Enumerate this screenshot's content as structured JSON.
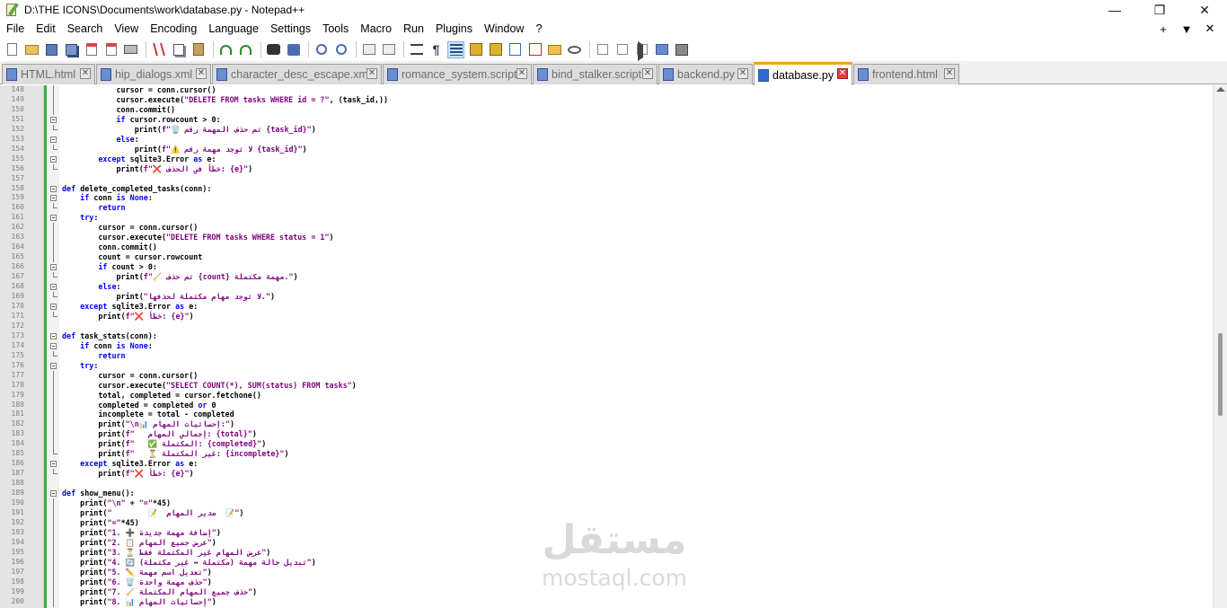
{
  "window": {
    "title": "D:\\THE ICONS\\Documents\\work\\database.py - Notepad++",
    "controls": {
      "minimize": "—",
      "maximize": "❐",
      "close": "✕"
    }
  },
  "menu": {
    "items": [
      "File",
      "Edit",
      "Search",
      "View",
      "Encoding",
      "Language",
      "Settings",
      "Tools",
      "Macro",
      "Run",
      "Plugins",
      "Window",
      "?"
    ],
    "right": [
      "+",
      "▼",
      "✕"
    ]
  },
  "toolbar": {
    "icons": [
      "new-file-icon",
      "open-file-icon",
      "save-icon",
      "save-all-icon",
      "close-file-icon",
      "close-all-icon",
      "print-icon",
      "cut-icon",
      "copy-icon",
      "paste-icon",
      "undo-icon",
      "redo-icon",
      "find-icon",
      "replace-icon",
      "zoom-in-icon",
      "zoom-out-icon",
      "sync-vertical-icon",
      "sync-horizontal-icon",
      "word-wrap-icon",
      "show-all-chars-icon",
      "indent-guide-icon",
      "user-language-icon",
      "document-map-icon",
      "document-list-icon",
      "function-list-icon",
      "folder-workspace-icon",
      "monitoring-icon",
      "record-macro-icon",
      "stop-macro-icon",
      "play-macro-icon",
      "run-macro-multiple-icon",
      "save-macro-icon"
    ],
    "active_icon": "indent-guide-icon",
    "pilcrow": "¶"
  },
  "tabs": [
    {
      "label": "HTML.html",
      "active": false
    },
    {
      "label": "hip_dialogs.xml",
      "active": false
    },
    {
      "label": "character_desc_escape.xml",
      "active": false
    },
    {
      "label": "romance_system.script",
      "active": false
    },
    {
      "label": "bind_stalker.script",
      "active": false
    },
    {
      "label": "backend.py",
      "active": false
    },
    {
      "label": "database.py",
      "active": true
    },
    {
      "label": "frontend.html",
      "active": false
    }
  ],
  "tab_close_glyph": "✕",
  "editor": {
    "lines": [
      {
        "n": "148",
        "fold": "line",
        "code": "            cursor = conn.cursor()"
      },
      {
        "n": "149",
        "fold": "line",
        "code": "            cursor.execute(\"DELETE FROM tasks WHERE id = ?\", (task_id,))"
      },
      {
        "n": "150",
        "fold": "line",
        "code": "            conn.commit()"
      },
      {
        "n": "151",
        "fold": "box",
        "code": "            if cursor.rowcount > 0:"
      },
      {
        "n": "152",
        "fold": "end",
        "code": "                print(f\"🗑️ تم حذف المهمة رقم {task_id}\")"
      },
      {
        "n": "153",
        "fold": "box",
        "code": "            else:"
      },
      {
        "n": "154",
        "fold": "end",
        "code": "                print(f\"⚠️ لا توجد مهمة رقم {task_id}\")"
      },
      {
        "n": "155",
        "fold": "box",
        "code": "        except sqlite3.Error as e:"
      },
      {
        "n": "156",
        "fold": "end",
        "code": "            print(f\"❌ خطأ في الحذف: {e}\")"
      },
      {
        "n": "157",
        "fold": "",
        "code": ""
      },
      {
        "n": "158",
        "fold": "box",
        "code": "def delete_completed_tasks(conn):"
      },
      {
        "n": "159",
        "fold": "box",
        "code": "    if conn is None:"
      },
      {
        "n": "160",
        "fold": "end",
        "code": "        return"
      },
      {
        "n": "161",
        "fold": "box",
        "code": "    try:"
      },
      {
        "n": "162",
        "fold": "line",
        "code": "        cursor = conn.cursor()"
      },
      {
        "n": "163",
        "fold": "line",
        "code": "        cursor.execute(\"DELETE FROM tasks WHERE status = 1\")"
      },
      {
        "n": "164",
        "fold": "line",
        "code": "        conn.commit()"
      },
      {
        "n": "165",
        "fold": "line",
        "code": "        count = cursor.rowcount"
      },
      {
        "n": "166",
        "fold": "box",
        "code": "        if count > 0:"
      },
      {
        "n": "167",
        "fold": "end",
        "code": "            print(f\"🧹 تم حذف {count} مهمة مكتملة.\")"
      },
      {
        "n": "168",
        "fold": "box",
        "code": "        else:"
      },
      {
        "n": "169",
        "fold": "end",
        "code": "            print(\"لا توجد مهام مكتملة لحذفها.\")"
      },
      {
        "n": "170",
        "fold": "box",
        "code": "    except sqlite3.Error as e:"
      },
      {
        "n": "171",
        "fold": "end",
        "code": "        print(f\"❌ خطأ: {e}\")"
      },
      {
        "n": "172",
        "fold": "",
        "code": ""
      },
      {
        "n": "173",
        "fold": "box",
        "code": "def task_stats(conn):"
      },
      {
        "n": "174",
        "fold": "box",
        "code": "    if conn is None:"
      },
      {
        "n": "175",
        "fold": "end",
        "code": "        return"
      },
      {
        "n": "176",
        "fold": "box",
        "code": "    try:"
      },
      {
        "n": "177",
        "fold": "line",
        "code": "        cursor = conn.cursor()"
      },
      {
        "n": "178",
        "fold": "line",
        "code": "        cursor.execute(\"SELECT COUNT(*), SUM(status) FROM tasks\")"
      },
      {
        "n": "179",
        "fold": "line",
        "code": "        total, completed = cursor.fetchone()"
      },
      {
        "n": "180",
        "fold": "line",
        "code": "        completed = completed or 0"
      },
      {
        "n": "181",
        "fold": "line",
        "code": "        incomplete = total - completed"
      },
      {
        "n": "182",
        "fold": "line",
        "code": "        print(\"\\n📊 إحصائيات المهام:\")"
      },
      {
        "n": "183",
        "fold": "line",
        "code": "        print(f\"   إجمالي المهام: {total}\")"
      },
      {
        "n": "184",
        "fold": "line",
        "code": "        print(f\"   ✅ المكتملة: {completed}\")"
      },
      {
        "n": "185",
        "fold": "end",
        "code": "        print(f\"   ⏳ غير المكتملة: {incomplete}\")"
      },
      {
        "n": "186",
        "fold": "box",
        "code": "    except sqlite3.Error as e:"
      },
      {
        "n": "187",
        "fold": "end",
        "code": "        print(f\"❌ خطأ: {e}\")"
      },
      {
        "n": "188",
        "fold": "",
        "code": ""
      },
      {
        "n": "189",
        "fold": "box",
        "code": "def show_menu():"
      },
      {
        "n": "190",
        "fold": "line",
        "code": "    print(\"\\n\" + \"=\"*45)"
      },
      {
        "n": "191",
        "fold": "line",
        "code": "    print(\"        📝  مدير المهام  📝\")"
      },
      {
        "n": "192",
        "fold": "line",
        "code": "    print(\"=\"*45)"
      },
      {
        "n": "193",
        "fold": "line",
        "code": "    print(\"1. ➕ إضافة مهمة جديدة\")"
      },
      {
        "n": "194",
        "fold": "line",
        "code": "    print(\"2. 📋 عرض جميع المهام\")"
      },
      {
        "n": "195",
        "fold": "line",
        "code": "    print(\"3. ⏳ عرض المهام غير المكتملة فقط\")"
      },
      {
        "n": "196",
        "fold": "line",
        "code": "    print(\"4. 🔄 تبديل حالة مهمة (مكتملة ↔ غير مكتملة)\")"
      },
      {
        "n": "197",
        "fold": "line",
        "code": "    print(\"5. ✏️ تعديل اسم مهمة\")"
      },
      {
        "n": "198",
        "fold": "line",
        "code": "    print(\"6. 🗑️ حذف مهمة واحدة\")"
      },
      {
        "n": "199",
        "fold": "line",
        "code": "    print(\"7. 🧹 حذف جميع المهام المكتملة\")"
      },
      {
        "n": "200",
        "fold": "line",
        "code": "    print(\"8. 📊 إحصائيات المهام\")"
      }
    ]
  },
  "watermark": {
    "arabic": "مستقل",
    "latin": "mostaql.com"
  },
  "colors": {
    "keyword": "#0000ff",
    "string": "#7f007f",
    "line_number": "#808080",
    "change_bar": "#3cb43c",
    "active_tab_accent": "#f8a21a"
  }
}
